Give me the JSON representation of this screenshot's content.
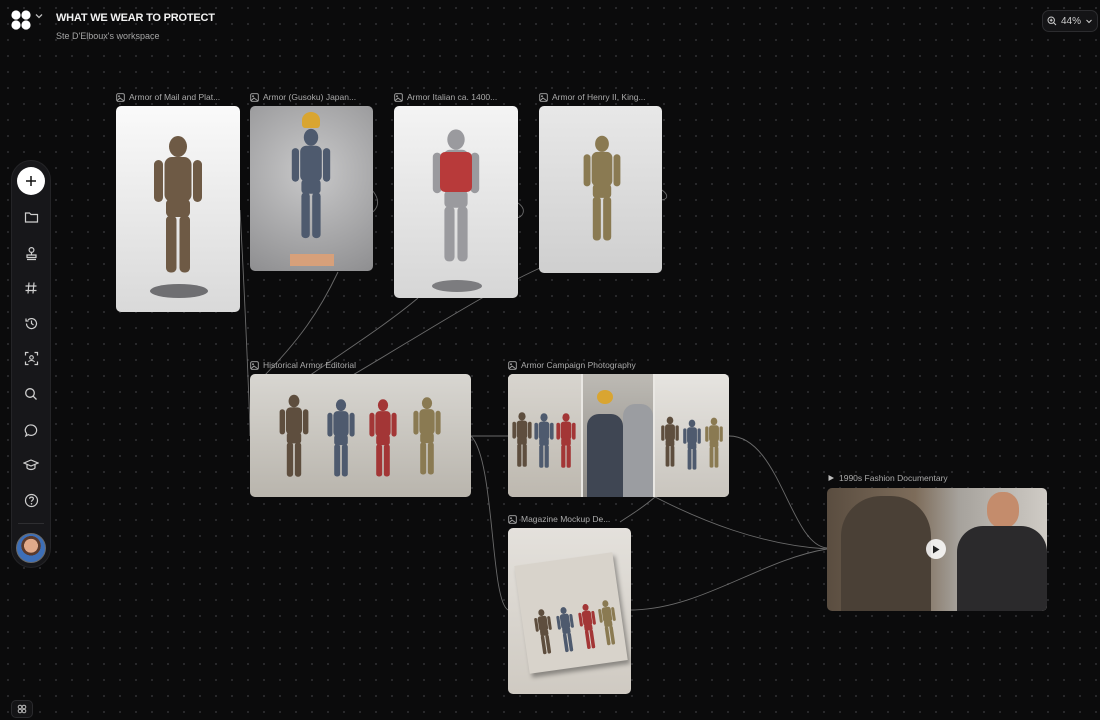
{
  "header": {
    "title": "WHAT WE WEAR TO PROTECT",
    "workspace": "Ste D'Elboux's workspace",
    "zoom": "44%"
  },
  "sidebar": {
    "items": [
      {
        "name": "add",
        "icon": "plus-icon"
      },
      {
        "name": "files",
        "icon": "folder-icon"
      },
      {
        "name": "stamp",
        "icon": "stamp-icon"
      },
      {
        "name": "tags",
        "icon": "hash-icon"
      },
      {
        "name": "history",
        "icon": "history-icon"
      },
      {
        "name": "scan",
        "icon": "scan-face-icon"
      },
      {
        "name": "search",
        "icon": "search-icon"
      },
      {
        "name": "comments",
        "icon": "chat-bubble-icon"
      },
      {
        "name": "learn",
        "icon": "graduation-cap-icon"
      },
      {
        "name": "help",
        "icon": "help-circle-icon"
      }
    ]
  },
  "nodes": {
    "armor_mail": {
      "label": "Armor of Mail and Plat..."
    },
    "armor_gusoku": {
      "label": "Armor (Gusoku) Japan..."
    },
    "armor_italian": {
      "label": "Armor Italian ca. 1400..."
    },
    "armor_henry": {
      "label": "Armor of Henry II, King..."
    },
    "editorial": {
      "label": "Historical Armor Editorial"
    },
    "campaign": {
      "label": "Armor Campaign Photography"
    },
    "magazine": {
      "label": "Magazine Mockup De..."
    },
    "documentary": {
      "label": "1990s Fashion Documentary"
    }
  },
  "colors": {
    "background": "#0b0b0c",
    "wire": "#8a8a8a",
    "sidebar": "#17171a"
  }
}
